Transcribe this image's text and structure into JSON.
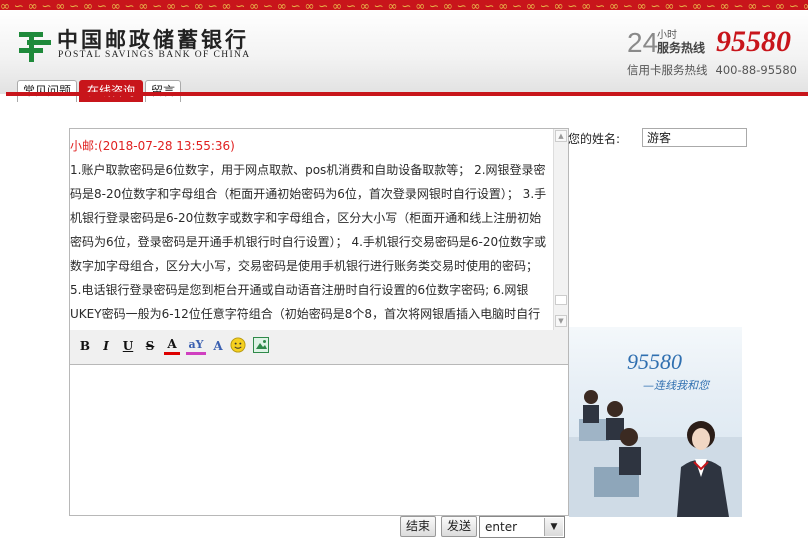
{
  "brand": {
    "name_cn": "中国邮政储蓄银行",
    "name_en": "POSTAL SAVINGS BANK OF CHINA",
    "accent_color": "#c8151b",
    "logo_icon": "psbc-logo-icon"
  },
  "hotline": {
    "num_24": "24",
    "label_hours": "小时",
    "label_service": "服务热线",
    "number": "95580",
    "card_label": "信用卡服务热线",
    "card_number": "400-88-95580"
  },
  "tabs": [
    {
      "label": "常见问题",
      "active": false
    },
    {
      "label": "在线咨询",
      "active": true
    },
    {
      "label": "留言",
      "active": false
    }
  ],
  "chat": {
    "sender": "小邮:",
    "timestamp": "(2018-07-28 13:55:36)",
    "message": "1.账户取款密码是6位数字，用于网点取款、pos机消费和自助设备取款等； 2.网银登录密码是8-20位数字和字母组合（柜面开通初始密码为6位，首次登录网银时自行设置）； 3.手机银行登录密码是6-20位数字或数字和字母组合，区分大小写（柜面开通和线上注册初始密码为6位，登录密码是开通手机银行时自行设置）； 4.手机银行交易密码是6-20位数字或数字加字母组合，区分大小写，交易密码是使用手机银行进行账务类交易时使用的密码； 5.电话银行登录密码是您到柜台开通或自动语音注册时自行设置的6位数字密码; 6.网银UKEY密码一般为6-12位任意字符组合（初始密码是8个8，首次将网银盾插入电脑时自行设置，用于网"
  },
  "toolbar": {
    "bold": "B",
    "italic": "I",
    "underline": "U",
    "strike": "S",
    "font_color": "A",
    "highlight": "aY",
    "font_size": "A",
    "icons": [
      "bold-icon",
      "italic-icon",
      "underline-icon",
      "strikethrough-icon",
      "font-color-icon",
      "highlight-icon",
      "font-size-icon",
      "emoji-icon",
      "insert-image-icon"
    ]
  },
  "visitor": {
    "name_label": "您的姓名:",
    "name_value": "游客"
  },
  "ad": {
    "number": "95580",
    "slogan": "—连线我和您"
  },
  "actions": {
    "end_label": "结束",
    "send_label": "发送",
    "send_mode": "enter"
  }
}
